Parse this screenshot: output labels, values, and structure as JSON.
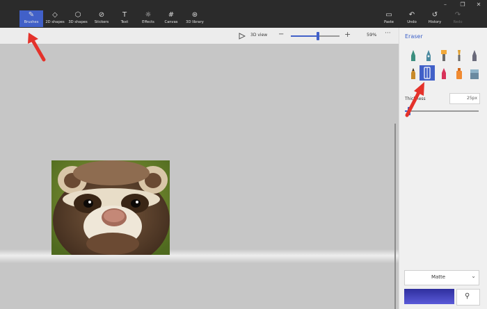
{
  "toolbar": {
    "tools": [
      {
        "label": "Brushes",
        "icon": "brush-icon"
      },
      {
        "label": "2D shapes",
        "icon": "2d-shapes-icon"
      },
      {
        "label": "3D shapes",
        "icon": "3d-shapes-icon"
      },
      {
        "label": "Stickers",
        "icon": "stickers-icon"
      },
      {
        "label": "Text",
        "icon": "text-icon"
      },
      {
        "label": "Effects",
        "icon": "effects-icon"
      },
      {
        "label": "Canvas",
        "icon": "canvas-icon"
      },
      {
        "label": "3D library",
        "icon": "3d-library-icon"
      }
    ],
    "actions": [
      {
        "label": "Paste",
        "icon": "paste-icon"
      },
      {
        "label": "Undo",
        "icon": "undo-icon"
      },
      {
        "label": "History",
        "icon": "history-icon"
      },
      {
        "label": "Redo",
        "icon": "redo-icon"
      }
    ]
  },
  "subbar": {
    "view3d_label": "3D view",
    "zoom_percent": "59%",
    "zoom_level": 0.55
  },
  "panel": {
    "title": "Eraser",
    "thickness_label": "Thickness",
    "thickness_value": "25px",
    "thickness_level": 0.06,
    "finish": "Matte",
    "color_hex": "#3a3fbf"
  },
  "colors": {
    "accent": "#4160c8",
    "ribbon": "#2b2b2b",
    "arrow": "#e4322b"
  }
}
